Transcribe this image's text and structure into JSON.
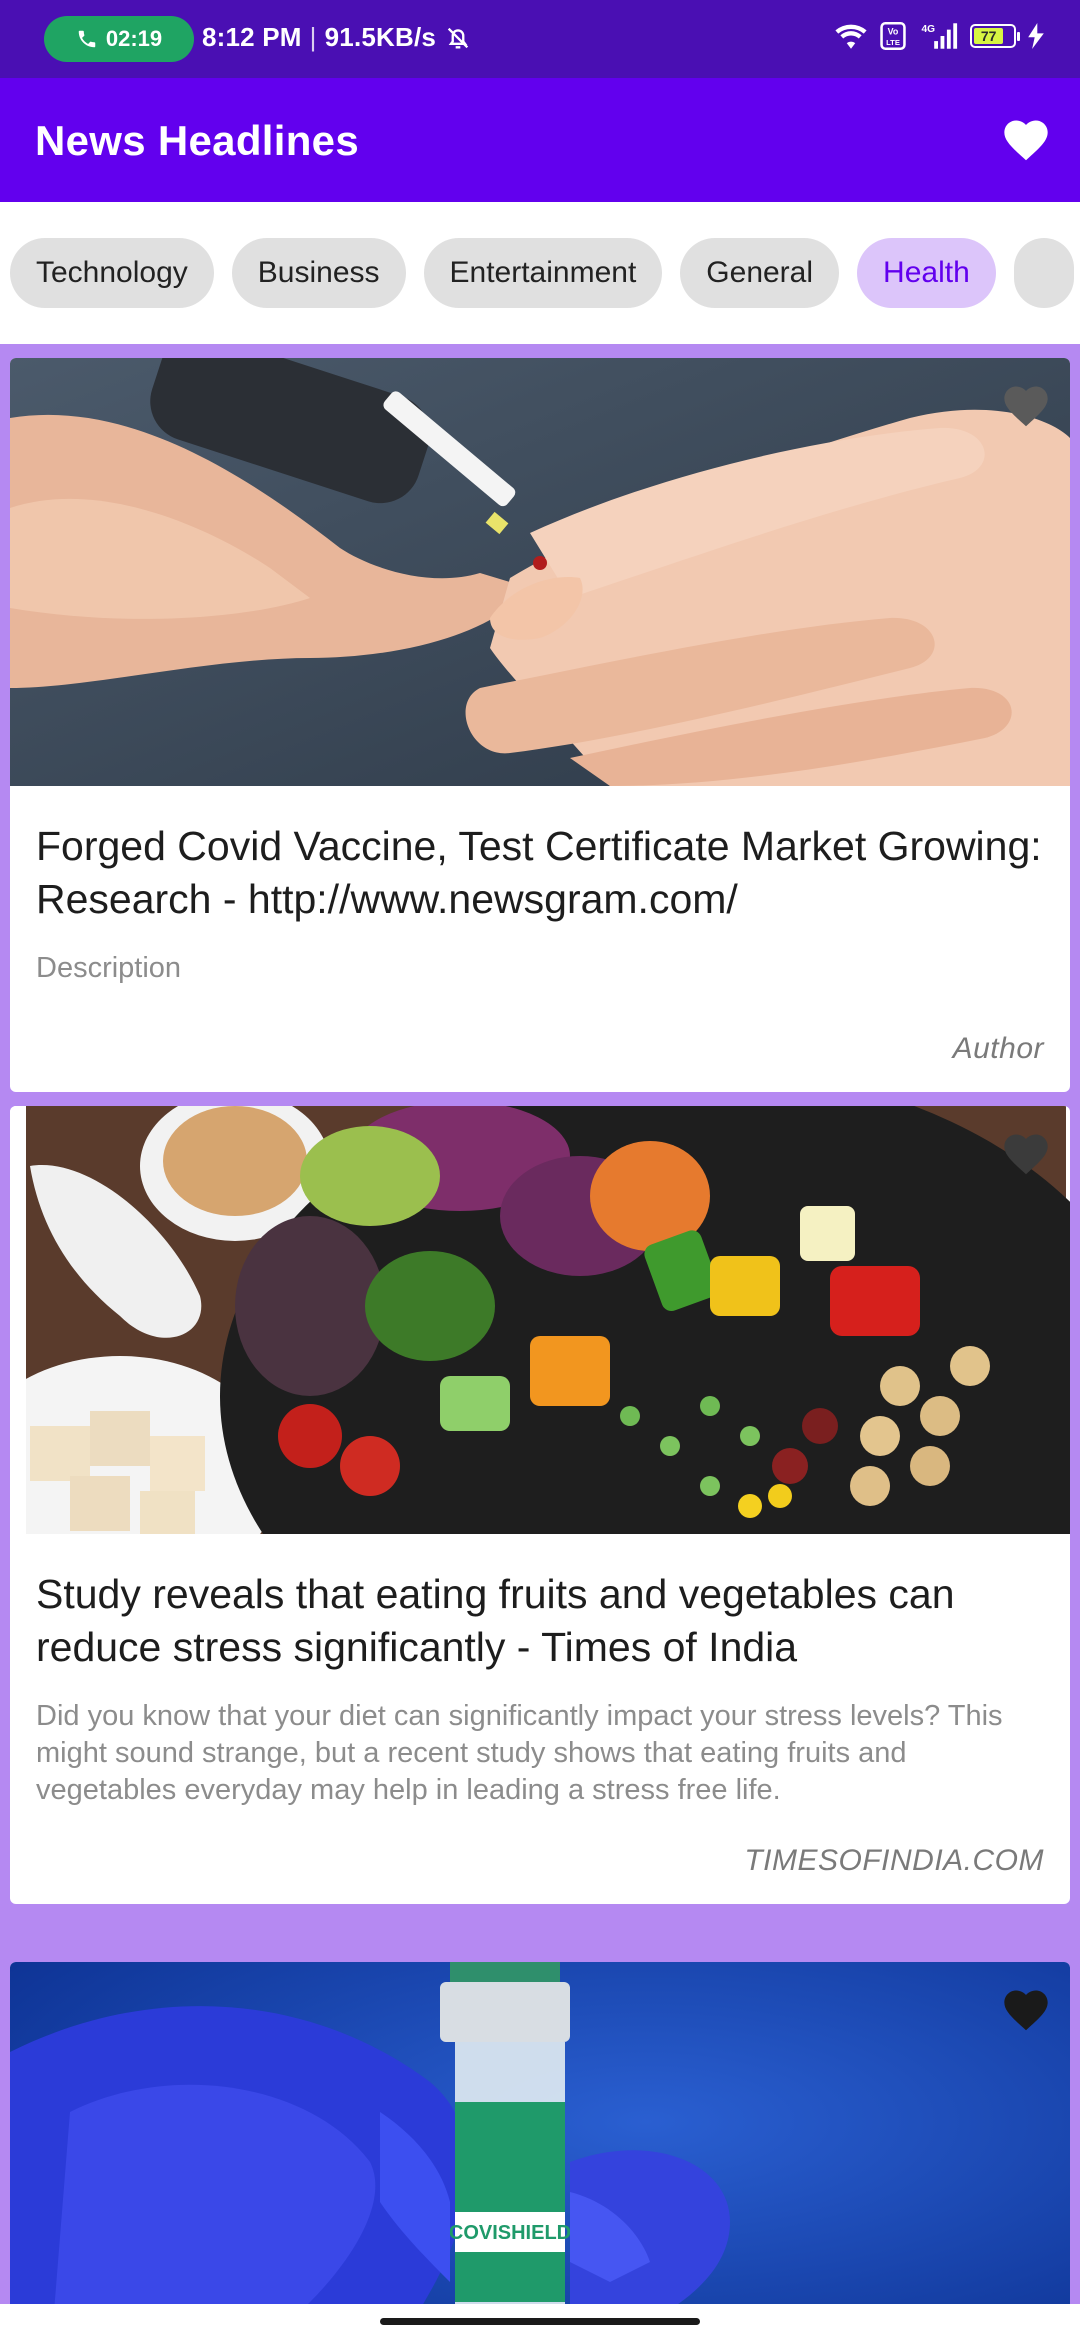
{
  "status_bar": {
    "call_timer": "02:19",
    "time": "8:12 PM",
    "separator": "|",
    "net_speed": "91.5KB/s",
    "network_label": "4G",
    "volte_label": "Vo LTE",
    "battery_level": "77"
  },
  "app_bar": {
    "title": "News Headlines"
  },
  "categories": {
    "items": [
      "Technology",
      "Business",
      "Entertainment",
      "General",
      "Health",
      ""
    ],
    "selected": "Health"
  },
  "articles": [
    {
      "image": "hand-glucose-test",
      "title": "Forged Covid Vaccine, Test Certificate Market Growing: Research - http://www.newsgram.com/",
      "description": "Description",
      "author": "Author"
    },
    {
      "image": "vegetable-salad-bowl",
      "title": "Study reveals that eating fruits and vegetables can reduce stress significantly - Times of India",
      "description": "Did you know that your diet can significantly impact your stress levels? This might sound strange, but a recent study shows that eating fruits and vegetables everyday may help in leading a stress free life.",
      "author": "TIMESOFINDIA.COM"
    },
    {
      "image": "covishield-vaccine-vial",
      "vial_label": "COVISHIELD"
    }
  ],
  "colors": {
    "status_bar": "#4a0fb3",
    "app_bar": "#6200ee",
    "feed_background": "#b589f2",
    "chip_selected_bg": "#dcc5fa",
    "chip_selected_text": "#6200ee",
    "call_pill": "#1fa463"
  },
  "icons": {
    "app_bar_action": "heart-icon",
    "card_action": "heart-icon",
    "call": "phone-icon",
    "mute": "bell-off-icon",
    "wifi": "wifi-icon",
    "signal": "signal-icon",
    "battery": "battery-icon",
    "charging": "bolt-icon"
  }
}
